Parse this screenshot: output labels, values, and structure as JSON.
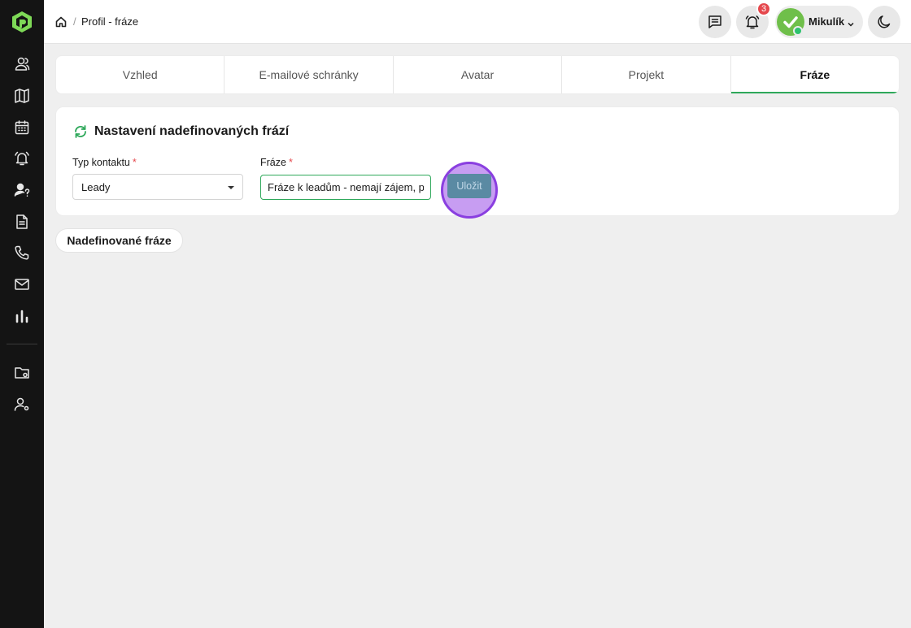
{
  "sidebar": {
    "items": [
      {
        "icon": "users-icon"
      },
      {
        "icon": "map-icon"
      },
      {
        "icon": "calendar-icon"
      },
      {
        "icon": "bell-alert-icon"
      },
      {
        "icon": "user-question-icon"
      },
      {
        "icon": "document-icon"
      },
      {
        "icon": "phone-icon"
      },
      {
        "icon": "mail-icon"
      },
      {
        "icon": "bar-chart-icon"
      },
      {
        "icon": "folder-settings-icon"
      },
      {
        "icon": "user-settings-icon"
      }
    ]
  },
  "header": {
    "breadcrumb_separator": "/",
    "page_title": "Profil - fráze",
    "notification_count": "3",
    "user_name": "Mikulík"
  },
  "tabs": [
    {
      "label": "Vzhled",
      "active": false
    },
    {
      "label": "E-mailové schránky",
      "active": false
    },
    {
      "label": "Avatar",
      "active": false
    },
    {
      "label": "Projekt",
      "active": false
    },
    {
      "label": "Fráze",
      "active": true
    }
  ],
  "card": {
    "title": "Nastavení nadefinovaných frází",
    "contact_type_label": "Typ kontaktu",
    "contact_type_value": "Leady",
    "phrase_label": "Fráze",
    "phrase_value": "Fráze k leadům - nemají zájem, pro",
    "required_mark": "*",
    "save_label": "Uložit"
  },
  "defined_phrases_label": "Nadefinované fráze",
  "colors": {
    "accent": "#2ea85a",
    "sidebar_bg": "#141414",
    "badge": "#e5484d",
    "save_button": "#5a8aa3"
  }
}
